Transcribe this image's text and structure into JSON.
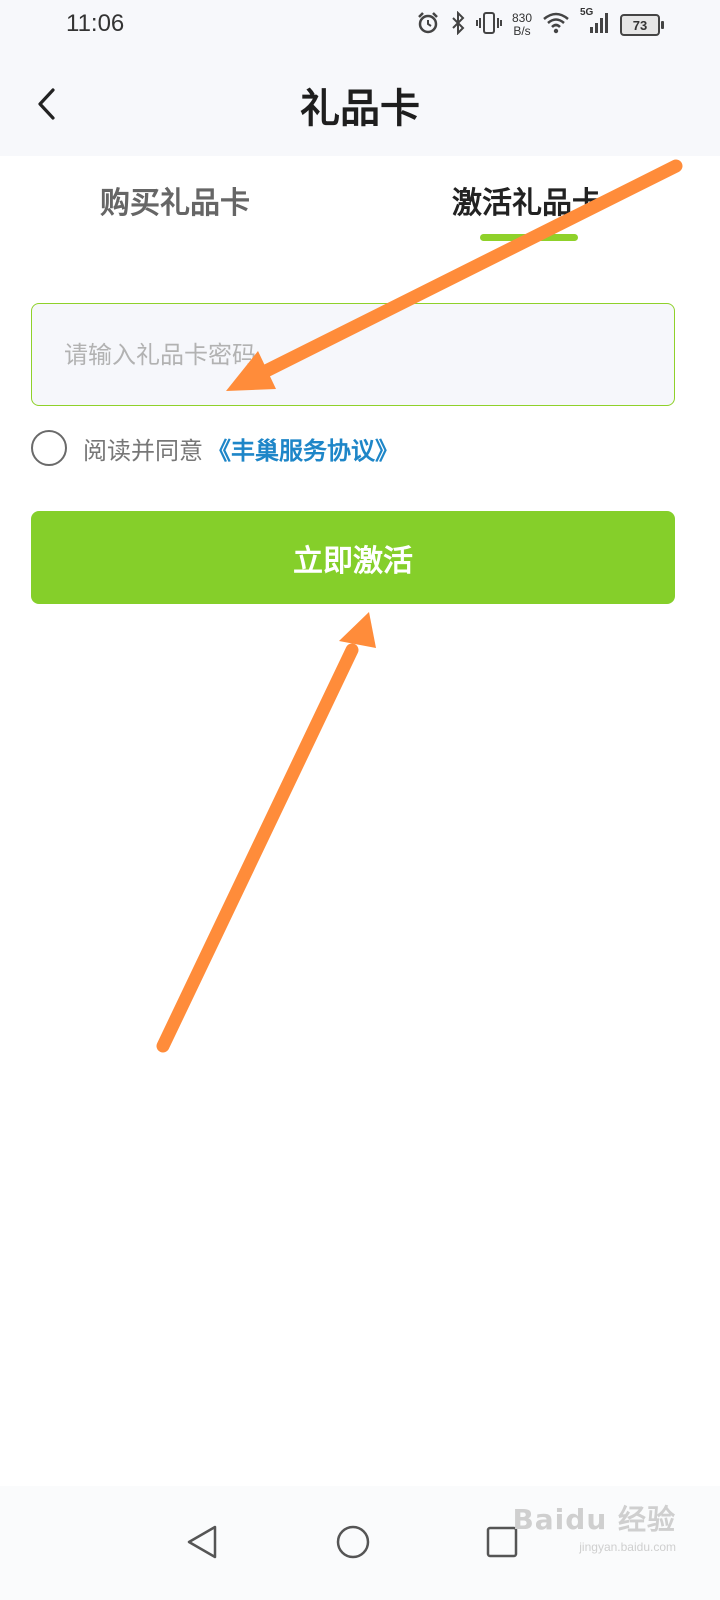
{
  "status_bar": {
    "time": "11:06",
    "net_speed_value": "830",
    "net_speed_unit": "B/s",
    "network_type": "5G",
    "battery_level": "73"
  },
  "header": {
    "title": "礼品卡"
  },
  "tabs": [
    {
      "label": "购买礼品卡",
      "active": false
    },
    {
      "label": "激活礼品卡",
      "active": true
    }
  ],
  "form": {
    "code_placeholder": "请输入礼品卡密码",
    "code_value": "",
    "agree_checked": false,
    "agree_text": "阅读并同意",
    "agree_link": "《丰巢服务协议》",
    "submit_label": "立即激活"
  },
  "watermark": {
    "brand": "Baidu 经验",
    "url": "jingyan.baidu.com"
  },
  "colors": {
    "accent_green": "#85cf2a",
    "link_blue": "#1e86c8",
    "annotation_orange": "#ff8c3a"
  },
  "icons": [
    "back-arrow-icon",
    "alarm-icon",
    "bluetooth-icon",
    "vibrate-icon",
    "wifi-icon",
    "signal-icon",
    "battery-icon",
    "nav-back-icon",
    "nav-home-icon",
    "nav-recent-icon"
  ]
}
